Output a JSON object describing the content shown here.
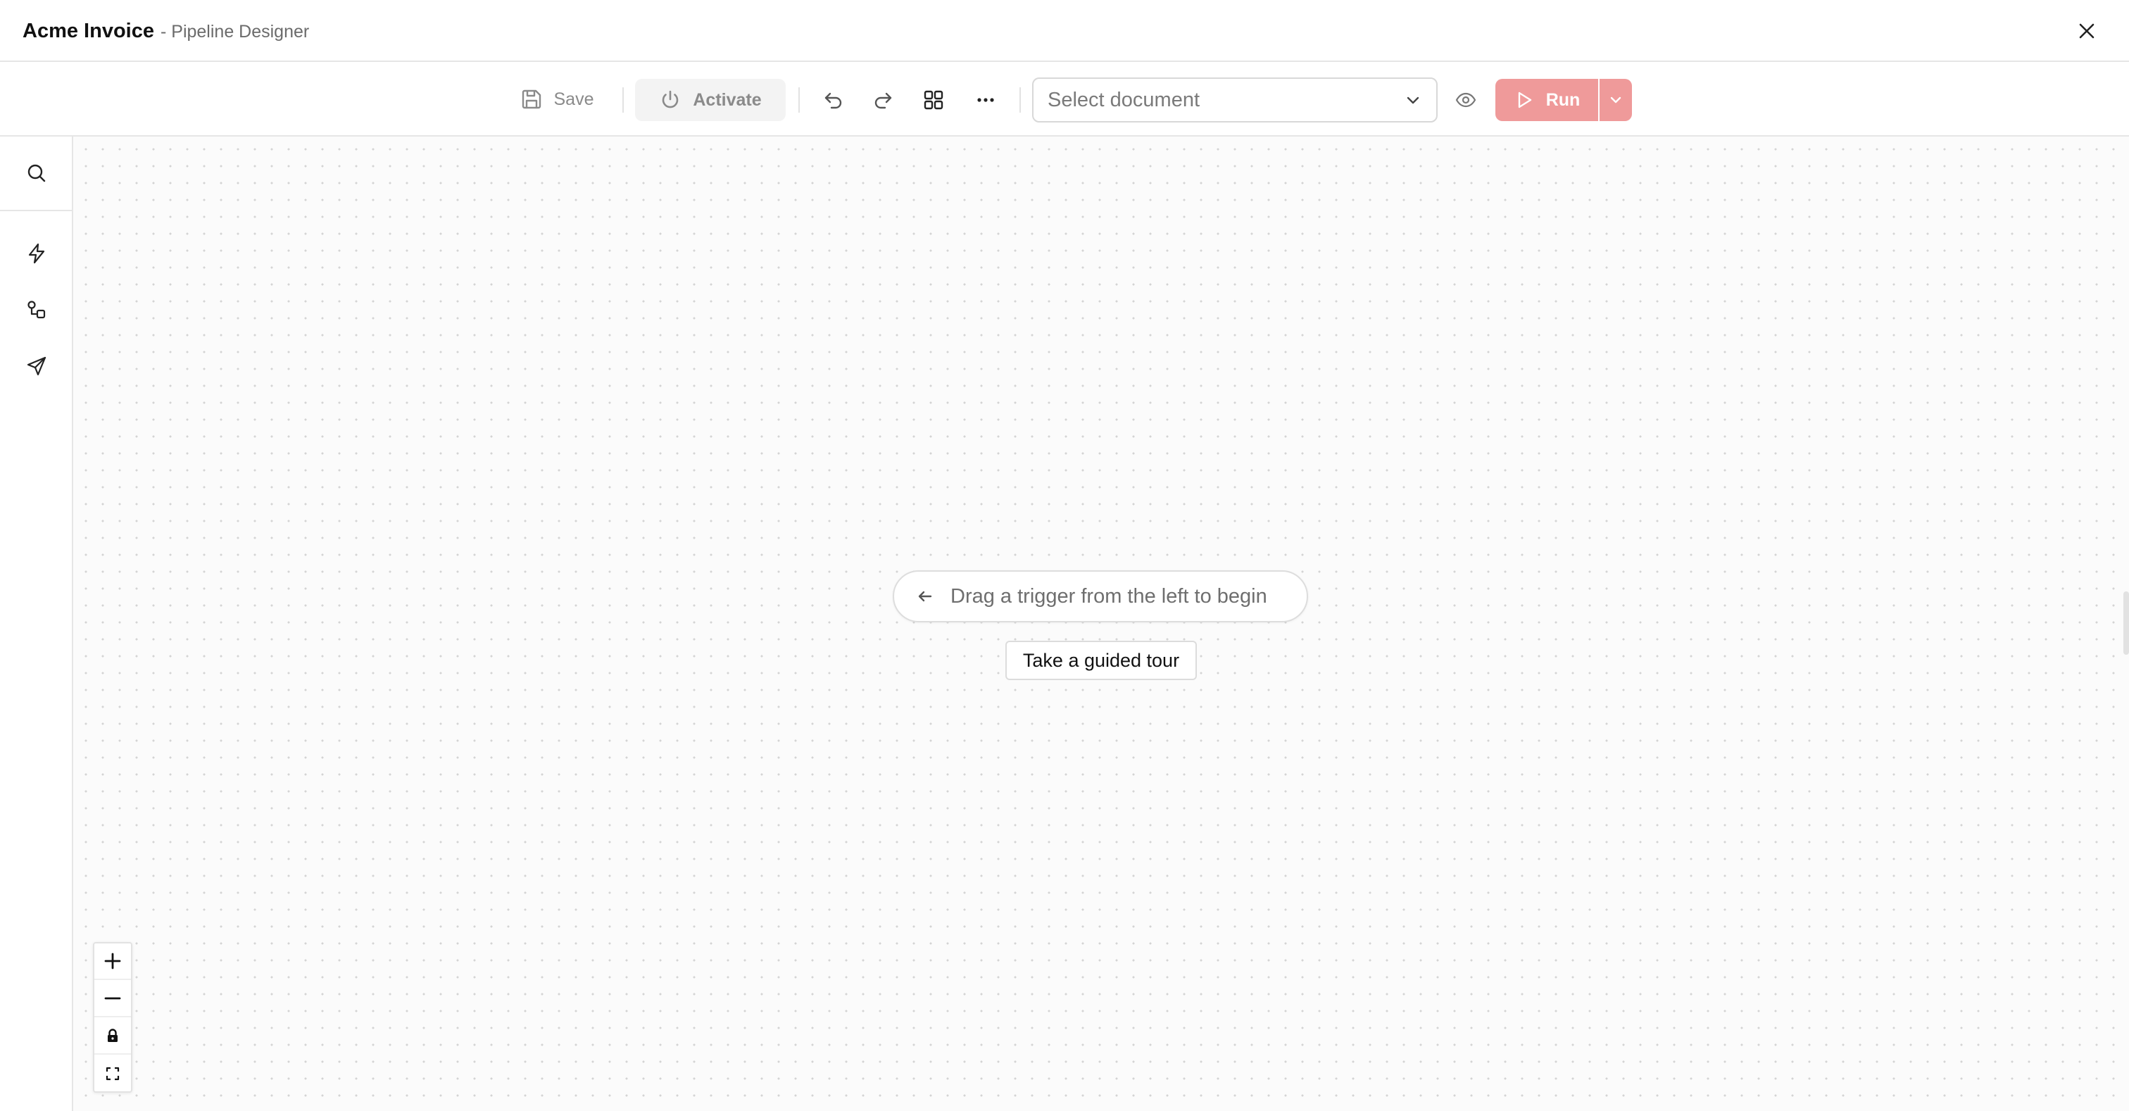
{
  "window": {
    "app_title": "Acme Invoice",
    "subtitle": "- Pipeline Designer",
    "close_icon": "close-icon"
  },
  "toolbar": {
    "save_label": "Save",
    "activate_label": "Activate",
    "icons": [
      "save-icon",
      "power-icon",
      "undo-icon",
      "redo-icon",
      "grid-icon",
      "more-horizontal-icon",
      "chevron-down-icon",
      "eye-icon",
      "play-icon"
    ],
    "document_select": {
      "placeholder": "Select document"
    },
    "run_label": "Run",
    "run_color": "#ef9a9a"
  },
  "rail": {
    "items": [
      "search-icon",
      "lightning-icon",
      "nodes-icon",
      "send-icon"
    ]
  },
  "canvas": {
    "hint_text": "Drag a trigger from the left to begin",
    "tour_label": "Take a guided tour",
    "zoom_controls": [
      "plus-icon",
      "minus-icon",
      "lock-icon",
      "fit-view-icon"
    ]
  }
}
